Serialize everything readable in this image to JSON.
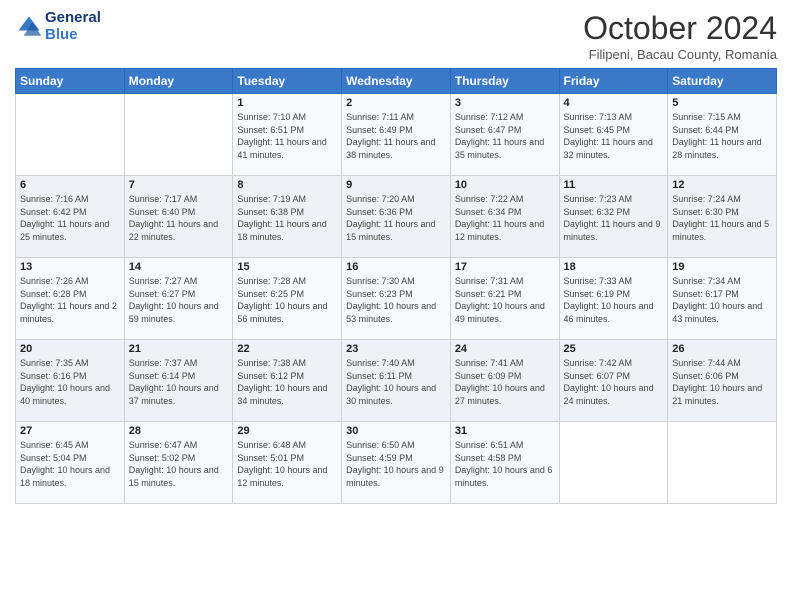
{
  "header": {
    "logo_main": "General",
    "logo_accent": "Blue",
    "month": "October 2024",
    "location": "Filipeni, Bacau County, Romania"
  },
  "weekdays": [
    "Sunday",
    "Monday",
    "Tuesday",
    "Wednesday",
    "Thursday",
    "Friday",
    "Saturday"
  ],
  "weeks": [
    [
      {
        "day": "",
        "sunrise": "",
        "sunset": "",
        "daylight": ""
      },
      {
        "day": "",
        "sunrise": "",
        "sunset": "",
        "daylight": ""
      },
      {
        "day": "1",
        "sunrise": "Sunrise: 7:10 AM",
        "sunset": "Sunset: 6:51 PM",
        "daylight": "Daylight: 11 hours and 41 minutes."
      },
      {
        "day": "2",
        "sunrise": "Sunrise: 7:11 AM",
        "sunset": "Sunset: 6:49 PM",
        "daylight": "Daylight: 11 hours and 38 minutes."
      },
      {
        "day": "3",
        "sunrise": "Sunrise: 7:12 AM",
        "sunset": "Sunset: 6:47 PM",
        "daylight": "Daylight: 11 hours and 35 minutes."
      },
      {
        "day": "4",
        "sunrise": "Sunrise: 7:13 AM",
        "sunset": "Sunset: 6:45 PM",
        "daylight": "Daylight: 11 hours and 32 minutes."
      },
      {
        "day": "5",
        "sunrise": "Sunrise: 7:15 AM",
        "sunset": "Sunset: 6:44 PM",
        "daylight": "Daylight: 11 hours and 28 minutes."
      }
    ],
    [
      {
        "day": "6",
        "sunrise": "Sunrise: 7:16 AM",
        "sunset": "Sunset: 6:42 PM",
        "daylight": "Daylight: 11 hours and 25 minutes."
      },
      {
        "day": "7",
        "sunrise": "Sunrise: 7:17 AM",
        "sunset": "Sunset: 6:40 PM",
        "daylight": "Daylight: 11 hours and 22 minutes."
      },
      {
        "day": "8",
        "sunrise": "Sunrise: 7:19 AM",
        "sunset": "Sunset: 6:38 PM",
        "daylight": "Daylight: 11 hours and 18 minutes."
      },
      {
        "day": "9",
        "sunrise": "Sunrise: 7:20 AM",
        "sunset": "Sunset: 6:36 PM",
        "daylight": "Daylight: 11 hours and 15 minutes."
      },
      {
        "day": "10",
        "sunrise": "Sunrise: 7:22 AM",
        "sunset": "Sunset: 6:34 PM",
        "daylight": "Daylight: 11 hours and 12 minutes."
      },
      {
        "day": "11",
        "sunrise": "Sunrise: 7:23 AM",
        "sunset": "Sunset: 6:32 PM",
        "daylight": "Daylight: 11 hours and 9 minutes."
      },
      {
        "day": "12",
        "sunrise": "Sunrise: 7:24 AM",
        "sunset": "Sunset: 6:30 PM",
        "daylight": "Daylight: 11 hours and 5 minutes."
      }
    ],
    [
      {
        "day": "13",
        "sunrise": "Sunrise: 7:26 AM",
        "sunset": "Sunset: 6:28 PM",
        "daylight": "Daylight: 11 hours and 2 minutes."
      },
      {
        "day": "14",
        "sunrise": "Sunrise: 7:27 AM",
        "sunset": "Sunset: 6:27 PM",
        "daylight": "Daylight: 10 hours and 59 minutes."
      },
      {
        "day": "15",
        "sunrise": "Sunrise: 7:28 AM",
        "sunset": "Sunset: 6:25 PM",
        "daylight": "Daylight: 10 hours and 56 minutes."
      },
      {
        "day": "16",
        "sunrise": "Sunrise: 7:30 AM",
        "sunset": "Sunset: 6:23 PM",
        "daylight": "Daylight: 10 hours and 53 minutes."
      },
      {
        "day": "17",
        "sunrise": "Sunrise: 7:31 AM",
        "sunset": "Sunset: 6:21 PM",
        "daylight": "Daylight: 10 hours and 49 minutes."
      },
      {
        "day": "18",
        "sunrise": "Sunrise: 7:33 AM",
        "sunset": "Sunset: 6:19 PM",
        "daylight": "Daylight: 10 hours and 46 minutes."
      },
      {
        "day": "19",
        "sunrise": "Sunrise: 7:34 AM",
        "sunset": "Sunset: 6:17 PM",
        "daylight": "Daylight: 10 hours and 43 minutes."
      }
    ],
    [
      {
        "day": "20",
        "sunrise": "Sunrise: 7:35 AM",
        "sunset": "Sunset: 6:16 PM",
        "daylight": "Daylight: 10 hours and 40 minutes."
      },
      {
        "day": "21",
        "sunrise": "Sunrise: 7:37 AM",
        "sunset": "Sunset: 6:14 PM",
        "daylight": "Daylight: 10 hours and 37 minutes."
      },
      {
        "day": "22",
        "sunrise": "Sunrise: 7:38 AM",
        "sunset": "Sunset: 6:12 PM",
        "daylight": "Daylight: 10 hours and 34 minutes."
      },
      {
        "day": "23",
        "sunrise": "Sunrise: 7:40 AM",
        "sunset": "Sunset: 6:11 PM",
        "daylight": "Daylight: 10 hours and 30 minutes."
      },
      {
        "day": "24",
        "sunrise": "Sunrise: 7:41 AM",
        "sunset": "Sunset: 6:09 PM",
        "daylight": "Daylight: 10 hours and 27 minutes."
      },
      {
        "day": "25",
        "sunrise": "Sunrise: 7:42 AM",
        "sunset": "Sunset: 6:07 PM",
        "daylight": "Daylight: 10 hours and 24 minutes."
      },
      {
        "day": "26",
        "sunrise": "Sunrise: 7:44 AM",
        "sunset": "Sunset: 6:06 PM",
        "daylight": "Daylight: 10 hours and 21 minutes."
      }
    ],
    [
      {
        "day": "27",
        "sunrise": "Sunrise: 6:45 AM",
        "sunset": "Sunset: 5:04 PM",
        "daylight": "Daylight: 10 hours and 18 minutes."
      },
      {
        "day": "28",
        "sunrise": "Sunrise: 6:47 AM",
        "sunset": "Sunset: 5:02 PM",
        "daylight": "Daylight: 10 hours and 15 minutes."
      },
      {
        "day": "29",
        "sunrise": "Sunrise: 6:48 AM",
        "sunset": "Sunset: 5:01 PM",
        "daylight": "Daylight: 10 hours and 12 minutes."
      },
      {
        "day": "30",
        "sunrise": "Sunrise: 6:50 AM",
        "sunset": "Sunset: 4:59 PM",
        "daylight": "Daylight: 10 hours and 9 minutes."
      },
      {
        "day": "31",
        "sunrise": "Sunrise: 6:51 AM",
        "sunset": "Sunset: 4:58 PM",
        "daylight": "Daylight: 10 hours and 6 minutes."
      },
      {
        "day": "",
        "sunrise": "",
        "sunset": "",
        "daylight": ""
      },
      {
        "day": "",
        "sunrise": "",
        "sunset": "",
        "daylight": ""
      }
    ]
  ]
}
